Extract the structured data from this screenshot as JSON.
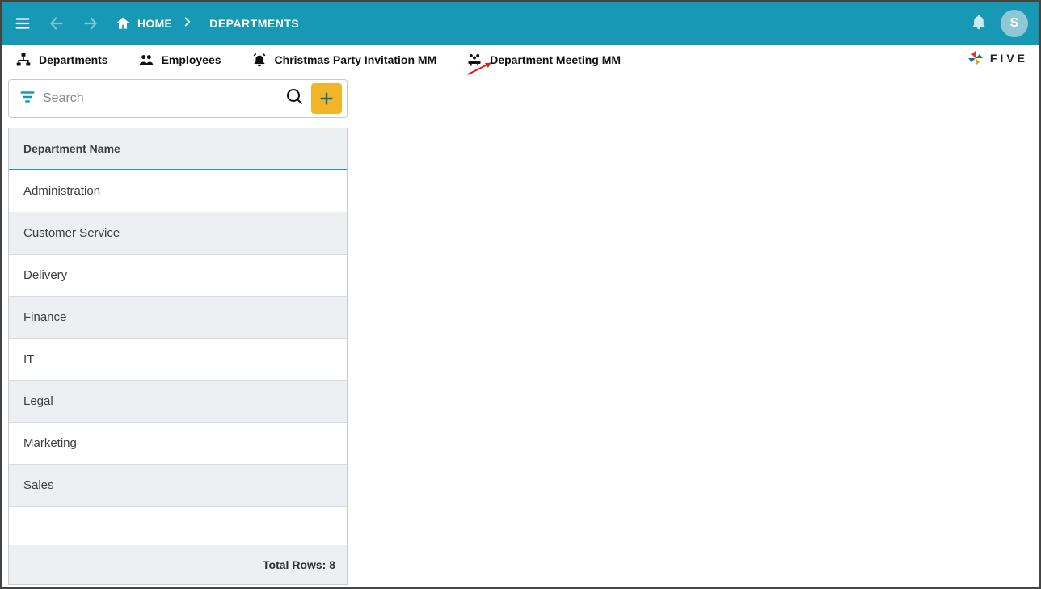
{
  "topbar": {
    "home_label": "HOME",
    "current_label": "DEPARTMENTS",
    "avatar_initial": "S"
  },
  "tabs": [
    {
      "label": "Departments"
    },
    {
      "label": "Employees"
    },
    {
      "label": "Christmas Party Invitation MM"
    },
    {
      "label": "Department Meeting MM"
    }
  ],
  "brand": {
    "label": "FIVE"
  },
  "search": {
    "placeholder": "Search"
  },
  "list": {
    "header": "Department Name",
    "rows": [
      "Administration",
      "Customer Service",
      "Delivery",
      "Finance",
      "IT",
      "Legal",
      "Marketing",
      "Sales"
    ],
    "footer_label": "Total Rows: 8"
  }
}
